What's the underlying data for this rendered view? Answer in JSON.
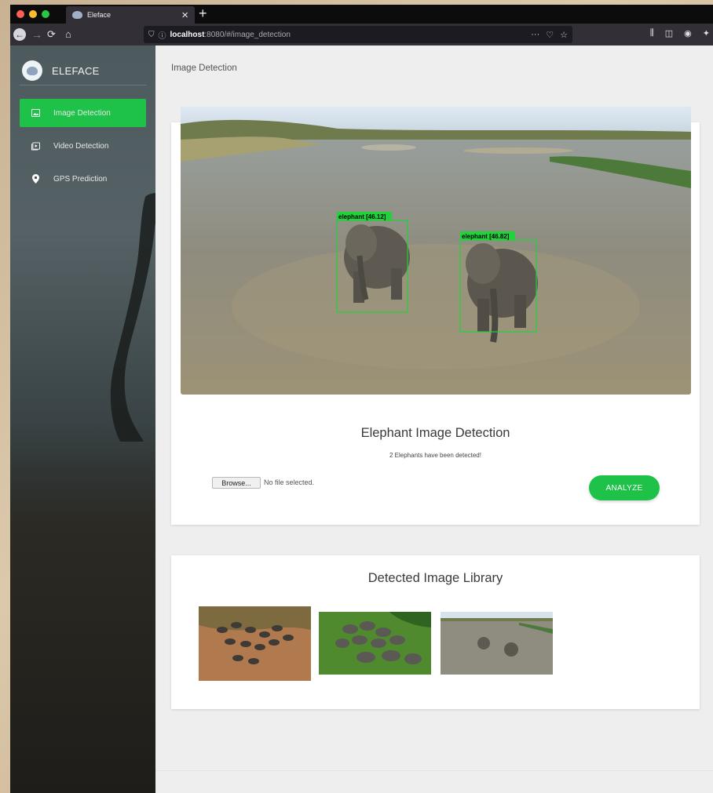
{
  "browser": {
    "tab_title": "Eleface",
    "tab_close": "×",
    "new_tab": "+",
    "url_host": "localhost",
    "url_path": ":8080/#/image_detection",
    "url_actions": "···",
    "light_colors": [
      "#fe5f57",
      "#febc2e",
      "#28c840"
    ]
  },
  "sidebar": {
    "brand": "ELEFACE",
    "items": [
      {
        "label": "Image Detection",
        "icon": "image-icon",
        "active": true
      },
      {
        "label": "Video Detection",
        "icon": "video-icon",
        "active": false
      },
      {
        "label": "GPS Prediction",
        "icon": "location-pin-icon",
        "active": false
      }
    ]
  },
  "main": {
    "page_title": "Image Detection",
    "detection": {
      "boxes": [
        {
          "label": "elephant [46.12]"
        },
        {
          "label": "elephant [46.82]"
        }
      ],
      "title": "Elephant Image Detection",
      "result": "2 Elephants have been detected!",
      "browse_label": "Browse...",
      "file_status": "No file selected.",
      "analyze_label": "ANALYZE"
    },
    "library": {
      "title": "Detected Image Library"
    }
  },
  "colors": {
    "accent": "#1ec249",
    "detection_box": "#1fd33a"
  }
}
